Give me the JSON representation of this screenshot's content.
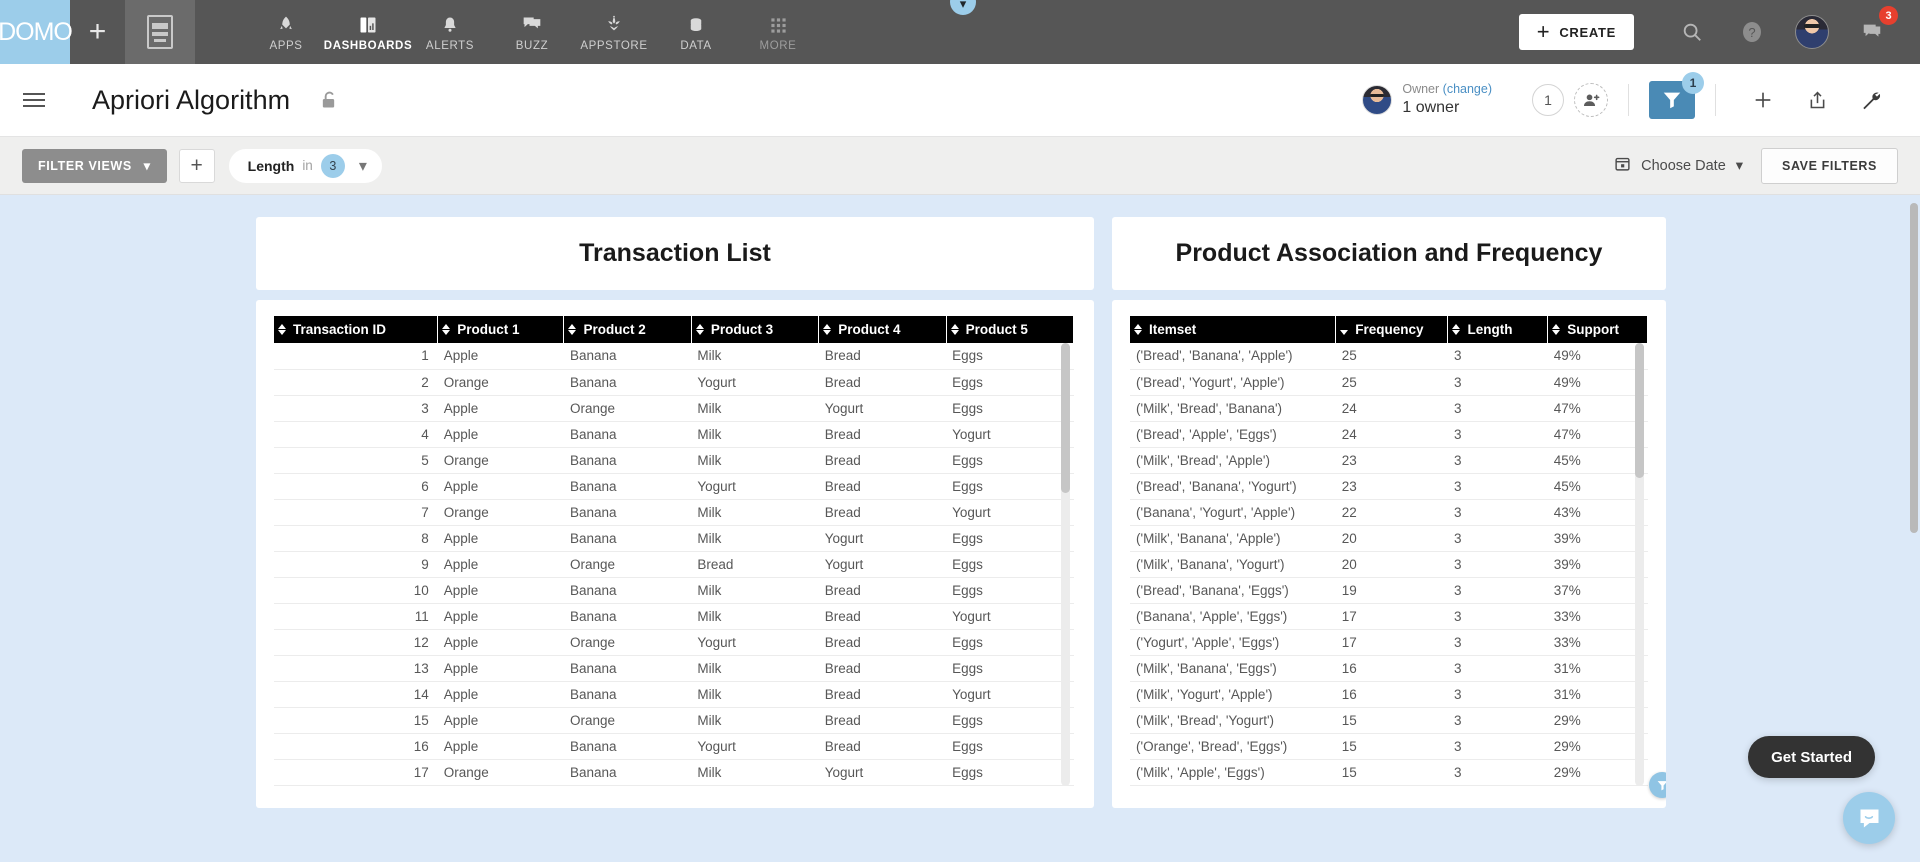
{
  "topnav": {
    "logo": "DOMO",
    "plus_label": "+",
    "items": [
      {
        "label": "APPS",
        "icon": "rocket-icon",
        "active": false
      },
      {
        "label": "DASHBOARDS",
        "icon": "dashboard-icon",
        "active": true
      },
      {
        "label": "ALERTS",
        "icon": "bell-icon",
        "active": false
      },
      {
        "label": "BUZZ",
        "icon": "chat-icon",
        "active": false
      },
      {
        "label": "APPSTORE",
        "icon": "appstore-icon",
        "active": false
      },
      {
        "label": "DATA",
        "icon": "database-icon",
        "active": false
      },
      {
        "label": "MORE",
        "icon": "grid-icon",
        "active": false,
        "dim": true
      }
    ],
    "create_label": "CREATE",
    "create_plus": "+",
    "search_icon": "search-icon",
    "help_icon": "help-icon",
    "avatar": "user-avatar",
    "buzz_icon": "buzz-icon",
    "buzz_badge": "3"
  },
  "pageheader": {
    "menu_icon": "hamburger-icon",
    "title": "Apriori Algorithm",
    "lock_icon": "unlock-icon",
    "owner_label": "Owner",
    "owner_change": "(change)",
    "owner_value": "1 owner",
    "people_count": "1",
    "add_person_icon": "add-person-icon",
    "filter_icon": "filter-icon",
    "filter_badge": "1",
    "add_icon": "plus-icon",
    "share_icon": "share-icon",
    "wrench_icon": "wrench-icon"
  },
  "filterbar": {
    "filter_views_label": "FILTER VIEWS",
    "add_filter_label": "+",
    "pill": {
      "name": "Length",
      "operator": "in",
      "value": "3"
    },
    "choose_date_label": "Choose Date",
    "calendar_icon": "calendar-icon",
    "save_filters_label": "SAVE FILTERS"
  },
  "cards": [
    {
      "title": "Transaction List",
      "columns": [
        "Transaction ID",
        "Product 1",
        "Product 2",
        "Product 3",
        "Product 4",
        "Product 5"
      ],
      "sort_states": [
        "both",
        "both",
        "both",
        "both",
        "both",
        "both"
      ],
      "rows": [
        [
          "1",
          "Apple",
          "Banana",
          "Milk",
          "Bread",
          "Eggs"
        ],
        [
          "2",
          "Orange",
          "Banana",
          "Yogurt",
          "Bread",
          "Eggs"
        ],
        [
          "3",
          "Apple",
          "Orange",
          "Milk",
          "Yogurt",
          "Eggs"
        ],
        [
          "4",
          "Apple",
          "Banana",
          "Milk",
          "Bread",
          "Yogurt"
        ],
        [
          "5",
          "Orange",
          "Banana",
          "Milk",
          "Bread",
          "Eggs"
        ],
        [
          "6",
          "Apple",
          "Banana",
          "Yogurt",
          "Bread",
          "Eggs"
        ],
        [
          "7",
          "Orange",
          "Banana",
          "Milk",
          "Bread",
          "Yogurt"
        ],
        [
          "8",
          "Apple",
          "Banana",
          "Milk",
          "Yogurt",
          "Eggs"
        ],
        [
          "9",
          "Apple",
          "Orange",
          "Bread",
          "Yogurt",
          "Eggs"
        ],
        [
          "10",
          "Apple",
          "Banana",
          "Milk",
          "Bread",
          "Eggs"
        ],
        [
          "11",
          "Apple",
          "Banana",
          "Milk",
          "Bread",
          "Yogurt"
        ],
        [
          "12",
          "Apple",
          "Orange",
          "Yogurt",
          "Bread",
          "Eggs"
        ],
        [
          "13",
          "Apple",
          "Banana",
          "Milk",
          "Bread",
          "Eggs"
        ],
        [
          "14",
          "Apple",
          "Banana",
          "Milk",
          "Bread",
          "Yogurt"
        ],
        [
          "15",
          "Apple",
          "Orange",
          "Milk",
          "Bread",
          "Eggs"
        ],
        [
          "16",
          "Apple",
          "Banana",
          "Yogurt",
          "Bread",
          "Eggs"
        ],
        [
          "17",
          "Orange",
          "Banana",
          "Milk",
          "Yogurt",
          "Eggs"
        ]
      ]
    },
    {
      "title": "Product Association and Frequency",
      "columns": [
        "Itemset",
        "Frequency",
        "Length",
        "Support"
      ],
      "sort_states": [
        "both",
        "desc",
        "both",
        "both"
      ],
      "rows": [
        [
          "('Bread', 'Banana', 'Apple')",
          "25",
          "3",
          "49%"
        ],
        [
          "('Bread', 'Yogurt', 'Apple')",
          "25",
          "3",
          "49%"
        ],
        [
          "('Milk', 'Bread', 'Banana')",
          "24",
          "3",
          "47%"
        ],
        [
          "('Bread', 'Apple', 'Eggs')",
          "24",
          "3",
          "47%"
        ],
        [
          "('Milk', 'Bread', 'Apple')",
          "23",
          "3",
          "45%"
        ],
        [
          "('Bread', 'Banana', 'Yogurt')",
          "23",
          "3",
          "45%"
        ],
        [
          "('Banana', 'Yogurt', 'Apple')",
          "22",
          "3",
          "43%"
        ],
        [
          "('Milk', 'Banana', 'Apple')",
          "20",
          "3",
          "39%"
        ],
        [
          "('Milk', 'Banana', 'Yogurt')",
          "20",
          "3",
          "39%"
        ],
        [
          "('Bread', 'Banana', 'Eggs')",
          "19",
          "3",
          "37%"
        ],
        [
          "('Banana', 'Apple', 'Eggs')",
          "17",
          "3",
          "33%"
        ],
        [
          "('Yogurt', 'Apple', 'Eggs')",
          "17",
          "3",
          "33%"
        ],
        [
          "('Milk', 'Banana', 'Eggs')",
          "16",
          "3",
          "31%"
        ],
        [
          "('Milk', 'Yogurt', 'Apple')",
          "16",
          "3",
          "31%"
        ],
        [
          "('Milk', 'Bread', 'Yogurt')",
          "15",
          "3",
          "29%"
        ],
        [
          "('Orange', 'Bread', 'Eggs')",
          "15",
          "3",
          "29%"
        ],
        [
          "('Milk', 'Apple', 'Eggs')",
          "15",
          "3",
          "29%"
        ]
      ]
    }
  ],
  "intercom": {
    "get_started_label": "Get Started",
    "messenger_icon": "messenger-icon"
  },
  "colors": {
    "brand_blue": "#9ccdea",
    "nav_bg": "#565656",
    "canvas_bg": "#dce9f8",
    "accent": "#4a8ab5",
    "badge_red": "#e7402e"
  }
}
